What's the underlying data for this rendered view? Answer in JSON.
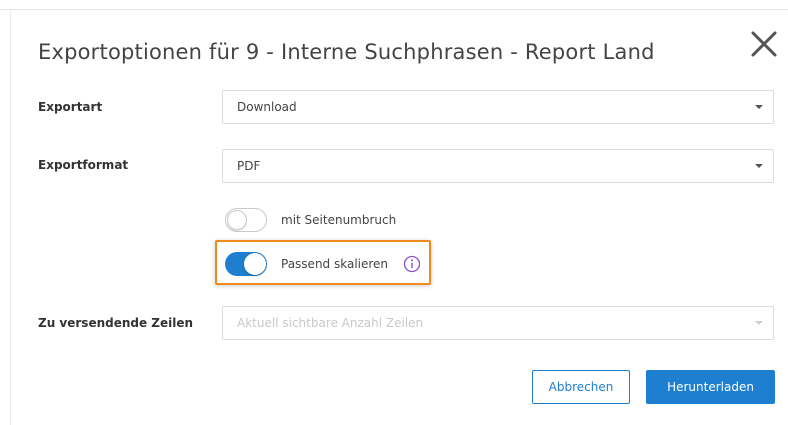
{
  "dialog": {
    "title": "Exportoptionen für 9 - Interne Suchphrasen - Report Land",
    "close_icon": "close-icon"
  },
  "form": {
    "export_type": {
      "label": "Exportart",
      "value": "Download"
    },
    "export_format": {
      "label": "Exportformat",
      "value": "PDF"
    },
    "page_break": {
      "label": "mit Seitenumbruch",
      "checked": false
    },
    "fit_scale": {
      "label": "Passend skalieren",
      "checked": true,
      "info_icon": "info-icon"
    },
    "rows": {
      "label": "Zu versendende Zeilen",
      "placeholder": "Aktuell sichtbare Anzahl Zeilen",
      "disabled": true
    }
  },
  "buttons": {
    "cancel": "Abbrechen",
    "download": "Herunterladen"
  },
  "colors": {
    "accent": "#1e7fd0",
    "highlight": "#f08a1c"
  }
}
